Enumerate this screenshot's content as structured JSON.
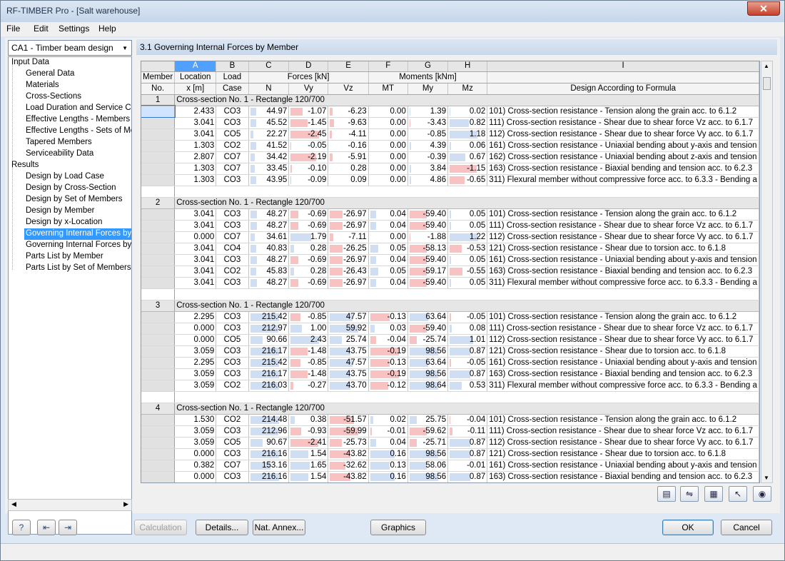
{
  "window": {
    "title": "RF-TIMBER Pro - [Salt warehouse]",
    "close_glyph": "✕"
  },
  "menu": [
    "File",
    "Edit",
    "Settings",
    "Help"
  ],
  "case_combo": {
    "value": "CA1 - Timber beam design"
  },
  "tree": {
    "input_root": "Input Data",
    "input_items": [
      "General Data",
      "Materials",
      "Cross-Sections",
      "Load Duration and Service Clas",
      "Effective Lengths - Members",
      "Effective Lengths - Sets of Mem",
      "Tapered Members",
      "Serviceability Data"
    ],
    "results_root": "Results",
    "results_items": [
      "Design by Load Case",
      "Design by Cross-Section",
      "Design by Set of Members",
      "Design by Member",
      "Design by x-Location",
      "Governing Internal Forces by M",
      "Governing Internal Forces by Se",
      "Parts List by Member",
      "Parts List by Set of Members"
    ],
    "selected": "Governing Internal Forces by M"
  },
  "panel_title": "3.1  Governing Internal Forces by Member",
  "table": {
    "col_letters": [
      "A",
      "B",
      "C",
      "D",
      "E",
      "F",
      "G",
      "H",
      "I"
    ],
    "hdr1": {
      "member": "Member",
      "location": "Location",
      "loadcase": "Load",
      "forces": "Forces [kN]",
      "moments": "Moments [kNm]"
    },
    "hdr2": {
      "member": "No.",
      "location": "x [m]",
      "loadcase": "Case",
      "n": "N",
      "vy": "Vy",
      "vz": "Vz",
      "mt": "MT",
      "my": "My",
      "mz": "Mz",
      "formula": "Design According to Formula"
    },
    "groups": [
      {
        "no": "1",
        "section": "Cross-section No. 1 - Rectangle 120/700",
        "rows": [
          [
            "2.433",
            "CO3",
            "44.97",
            "-1.07",
            "-6.23",
            "0.00",
            "1.39",
            "0.02",
            "101) Cross-section resistance - Tension along the grain acc. to 6.1.2"
          ],
          [
            "3.041",
            "CO3",
            "45.52",
            "-1.45",
            "-9.63",
            "0.00",
            "-3.43",
            "0.82",
            "111) Cross-section resistance - Shear due to shear force Vz acc. to 6.1.7"
          ],
          [
            "3.041",
            "CO5",
            "22.27",
            "-2.45",
            "-4.11",
            "0.00",
            "-0.85",
            "1.18",
            "112) Cross-section resistance - Shear due to shear force Vy acc. to 6.1.7"
          ],
          [
            "1.303",
            "CO2",
            "41.52",
            "-0.05",
            "-0.16",
            "0.00",
            "4.39",
            "0.06",
            "161) Cross-section resistance - Uniaxial bending about y-axis and tension"
          ],
          [
            "2.807",
            "CO7",
            "34.42",
            "-2.19",
            "-5.91",
            "0.00",
            "-0.39",
            "0.67",
            "162) Cross-section resistance - Uniaxial bending about z-axis and tension"
          ],
          [
            "1.303",
            "CO7",
            "33.45",
            "-0.10",
            "0.28",
            "0.00",
            "3.84",
            "-1.15",
            "163) Cross-section resistance - Biaxial bending and tension acc. to 6.2.3"
          ],
          [
            "1.303",
            "CO3",
            "43.95",
            "-0.09",
            "0.09",
            "0.00",
            "4.86",
            "-0.65",
            "311) Flexural member without compressive force acc. to 6.3.3 - Bending a"
          ]
        ]
      },
      {
        "no": "2",
        "section": "Cross-section No. 1 - Rectangle 120/700",
        "rows": [
          [
            "3.041",
            "CO3",
            "48.27",
            "-0.69",
            "-26.97",
            "0.04",
            "-59.40",
            "0.05",
            "101) Cross-section resistance - Tension along the grain acc. to 6.1.2"
          ],
          [
            "3.041",
            "CO3",
            "48.27",
            "-0.69",
            "-26.97",
            "0.04",
            "-59.40",
            "0.05",
            "111) Cross-section resistance - Shear due to shear force Vz acc. to 6.1.7"
          ],
          [
            "0.000",
            "CO7",
            "34.61",
            "1.79",
            "-7.11",
            "0.00",
            "-1.88",
            "1.22",
            "112) Cross-section resistance - Shear due to shear force Vy acc. to 6.1.7"
          ],
          [
            "3.041",
            "CO4",
            "40.83",
            "0.28",
            "-26.25",
            "0.05",
            "-58.13",
            "-0.53",
            "121) Cross-section resistance - Shear due to torsion acc. to 6.1.8"
          ],
          [
            "3.041",
            "CO3",
            "48.27",
            "-0.69",
            "-26.97",
            "0.04",
            "-59.40",
            "0.05",
            "161) Cross-section resistance - Uniaxial bending about y-axis and tension"
          ],
          [
            "3.041",
            "CO2",
            "45.83",
            "0.28",
            "-26.43",
            "0.05",
            "-59.17",
            "-0.55",
            "163) Cross-section resistance - Biaxial bending and tension acc. to 6.2.3"
          ],
          [
            "3.041",
            "CO3",
            "48.27",
            "-0.69",
            "-26.97",
            "0.04",
            "-59.40",
            "0.05",
            "311) Flexural member without compressive force acc. to 6.3.3 - Bending a"
          ]
        ]
      },
      {
        "no": "3",
        "section": "Cross-section No. 1 - Rectangle 120/700",
        "rows": [
          [
            "2.295",
            "CO3",
            "215.42",
            "-0.85",
            "47.57",
            "-0.13",
            "63.64",
            "-0.05",
            "101) Cross-section resistance - Tension along the grain acc. to 6.1.2"
          ],
          [
            "0.000",
            "CO3",
            "212.97",
            "1.00",
            "59.92",
            "0.03",
            "-59.40",
            "0.08",
            "111) Cross-section resistance - Shear due to shear force Vz acc. to 6.1.7"
          ],
          [
            "0.000",
            "CO5",
            "90.66",
            "2.43",
            "25.74",
            "-0.04",
            "-25.74",
            "1.01",
            "112) Cross-section resistance - Shear due to shear force Vy acc. to 6.1.7"
          ],
          [
            "3.059",
            "CO3",
            "216.17",
            "-1.48",
            "43.75",
            "-0.19",
            "98.56",
            "0.87",
            "121) Cross-section resistance - Shear due to torsion acc. to 6.1.8"
          ],
          [
            "2.295",
            "CO3",
            "215.42",
            "-0.85",
            "47.57",
            "-0.13",
            "63.64",
            "-0.05",
            "161) Cross-section resistance - Uniaxial bending about y-axis and tension"
          ],
          [
            "3.059",
            "CO3",
            "216.17",
            "-1.48",
            "43.75",
            "-0.19",
            "98.56",
            "0.87",
            "163) Cross-section resistance - Biaxial bending and tension acc. to 6.2.3"
          ],
          [
            "3.059",
            "CO2",
            "216.03",
            "-0.27",
            "43.70",
            "-0.12",
            "98.64",
            "0.53",
            "311) Flexural member without compressive force acc. to 6.3.3 - Bending a"
          ]
        ]
      },
      {
        "no": "4",
        "section": "Cross-section No. 1 - Rectangle 120/700",
        "rows": [
          [
            "1.530",
            "CO2",
            "214.48",
            "0.38",
            "-51.57",
            "0.02",
            "25.75",
            "-0.04",
            "101) Cross-section resistance - Tension along the grain acc. to 6.1.2"
          ],
          [
            "3.059",
            "CO3",
            "212.96",
            "-0.93",
            "-59.99",
            "-0.01",
            "-59.62",
            "-0.11",
            "111) Cross-section resistance - Shear due to shear force Vz acc. to 6.1.7"
          ],
          [
            "3.059",
            "CO5",
            "90.67",
            "-2.41",
            "-25.73",
            "0.04",
            "-25.71",
            "0.87",
            "112) Cross-section resistance - Shear due to shear force Vy acc. to 6.1.7"
          ],
          [
            "0.000",
            "CO3",
            "216.16",
            "1.54",
            "-43.82",
            "0.16",
            "98.56",
            "0.87",
            "121) Cross-section resistance - Shear due to torsion acc. to 6.1.8"
          ],
          [
            "0.382",
            "CO7",
            "153.16",
            "1.65",
            "-32.62",
            "0.13",
            "58.06",
            "-0.01",
            "161) Cross-section resistance - Uniaxial bending about y-axis and tension"
          ],
          [
            "0.000",
            "CO3",
            "216.16",
            "1.54",
            "-43.82",
            "0.16",
            "98.56",
            "0.87",
            "163) Cross-section resistance - Biaxial bending and tension acc. to 6.2.3"
          ]
        ]
      }
    ]
  },
  "buttons": {
    "calculation": "Calculation",
    "details": "Details...",
    "nat_annex": "Nat. Annex...",
    "graphics": "Graphics",
    "ok": "OK",
    "cancel": "Cancel"
  },
  "colors": {
    "accent": "#4fa0ff",
    "negative_bar": "#f7b7b7",
    "positive_bar": "#c8d8f2",
    "selected": "#3399ff"
  }
}
